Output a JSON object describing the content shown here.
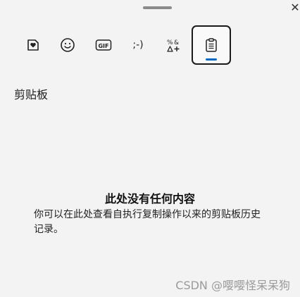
{
  "window": {
    "close_glyph": "✕"
  },
  "tabs": [
    {
      "name": "tab-favorites",
      "icon": "heart-sticker-icon",
      "label": ""
    },
    {
      "name": "tab-emoji",
      "icon": "smiley-icon",
      "label": ""
    },
    {
      "name": "tab-gif",
      "icon": "gif-icon",
      "label": "GIF"
    },
    {
      "name": "tab-kaomoji",
      "icon": "kaomoji-icon",
      "label": ";-)"
    },
    {
      "name": "tab-symbols",
      "icon": "symbols-icon",
      "label": ""
    },
    {
      "name": "tab-clipboard",
      "icon": "clipboard-icon",
      "label": "",
      "active": true
    }
  ],
  "section": {
    "title": "剪贴板"
  },
  "empty": {
    "title": "此处没有任何内容",
    "description": "你可以在此处查看自执行复制操作以来的剪贴板历史记录。"
  },
  "watermark": "CSDN @嘤嘤怪呆呆狗",
  "colors": {
    "background": "#f3f3f3",
    "accent": "#0067c0"
  }
}
